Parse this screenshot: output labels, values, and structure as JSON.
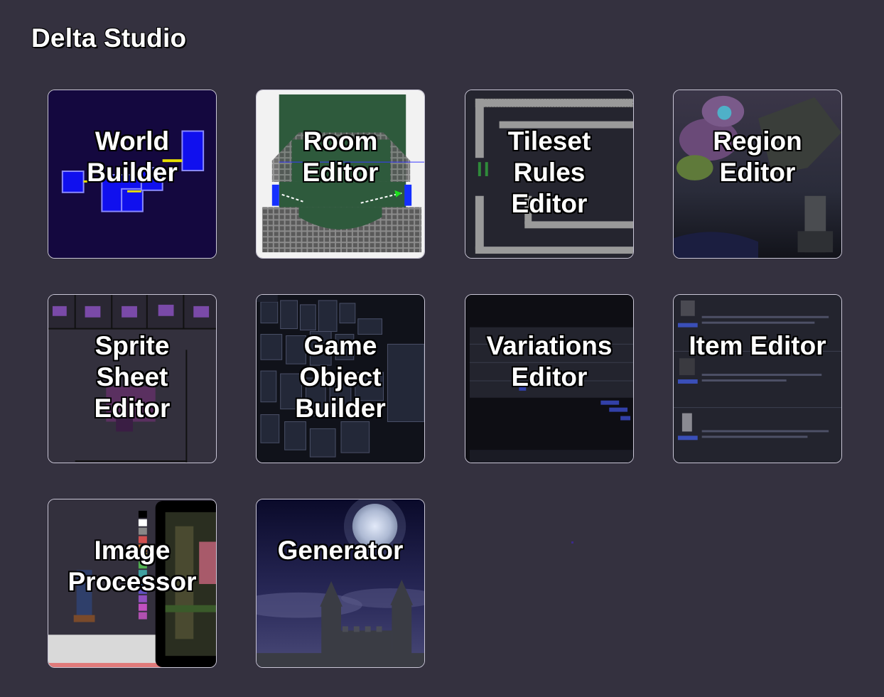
{
  "app": {
    "title": "Delta Studio"
  },
  "tools": [
    {
      "label": "World\nBuilder"
    },
    {
      "label": "Room\nEditor"
    },
    {
      "label": "Tileset\nRules\nEditor"
    },
    {
      "label": "Region\nEditor"
    },
    {
      "label": "Sprite\nSheet\nEditor"
    },
    {
      "label": "Game\nObject\nBuilder"
    },
    {
      "label": "Variations\nEditor"
    },
    {
      "label": "Item Editor"
    },
    {
      "label": "Image\nProcessor"
    },
    {
      "label": "Generator"
    }
  ],
  "colors": {
    "background": "#34313f",
    "tile_border": "#c9c6d6",
    "label_text": "#ffffff"
  }
}
